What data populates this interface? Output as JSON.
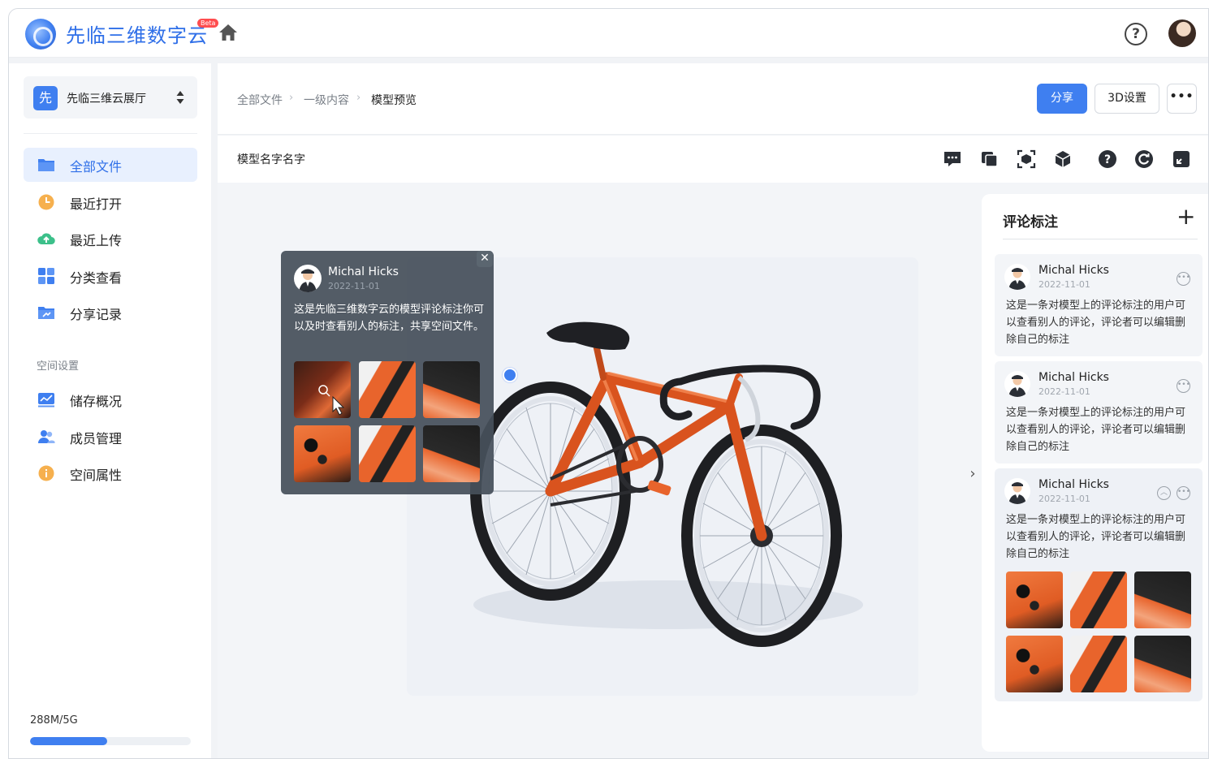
{
  "app": {
    "name": "先临三维数字云",
    "beta": "Beta",
    "colors": {
      "primary": "#3f7ff0",
      "background": "#f1f3f6"
    }
  },
  "header": {
    "home_icon": "home-icon",
    "help_icon": "question-circle-icon",
    "avatar_icon": "user-avatar"
  },
  "sidebar": {
    "space": {
      "badge": "先",
      "name": "先临三维云展厅"
    },
    "items": [
      {
        "label": "全部文件",
        "icon": "folder-icon",
        "active": true
      },
      {
        "label": "最近打开",
        "icon": "clock-icon"
      },
      {
        "label": "最近上传",
        "icon": "cloud-upload-icon"
      },
      {
        "label": "分类查看",
        "icon": "grid-icon"
      },
      {
        "label": "分享记录",
        "icon": "share-folder-icon"
      }
    ],
    "settings_title": "空间设置",
    "settings": [
      {
        "label": "储存概况",
        "icon": "chart-icon"
      },
      {
        "label": "成员管理",
        "icon": "users-icon"
      },
      {
        "label": "空间属性",
        "icon": "info-icon"
      }
    ],
    "storage": {
      "text": "288M/5G",
      "fraction": 0.48
    }
  },
  "breadcrumb": [
    "全部文件",
    "一级内容",
    "模型预览"
  ],
  "actions": {
    "share": "分享",
    "settings_3d": "3D设置",
    "more": "•••"
  },
  "model": {
    "name": "模型名字名字",
    "tools": [
      "comment-icon",
      "layers-icon",
      "scan-icon",
      "cube-icon",
      "help-icon",
      "reset-icon",
      "fullscreen-icon"
    ]
  },
  "popup": {
    "name": "Michal Hicks",
    "date": "2022-11-01",
    "text": "这是先临三维数字云的模型评论标注你可以及时查看别人的标注，共享空间文件。",
    "close": "✕"
  },
  "panel": {
    "title": "评论标注",
    "add": "+",
    "toggle": "›",
    "comments": [
      {
        "name": "Michal Hicks",
        "date": "2022-11-01",
        "text": "这是一条对模型上的评论标注的用户可以查看别人的评论，评论者可以编辑删除自己的标注"
      },
      {
        "name": "Michal Hicks",
        "date": "2022-11-01",
        "text": "这是一条对模型上的评论标注的用户可以查看别人的评论，评论者可以编辑删除自己的标注"
      },
      {
        "name": "Michal Hicks",
        "date": "2022-11-01",
        "text": "这是一条对模型上的评论标注的用户可以查看别人的评论，评论者可以编辑删除自己的标注"
      }
    ],
    "menu_glyph": "•••",
    "collapse_glyph": "︿"
  }
}
